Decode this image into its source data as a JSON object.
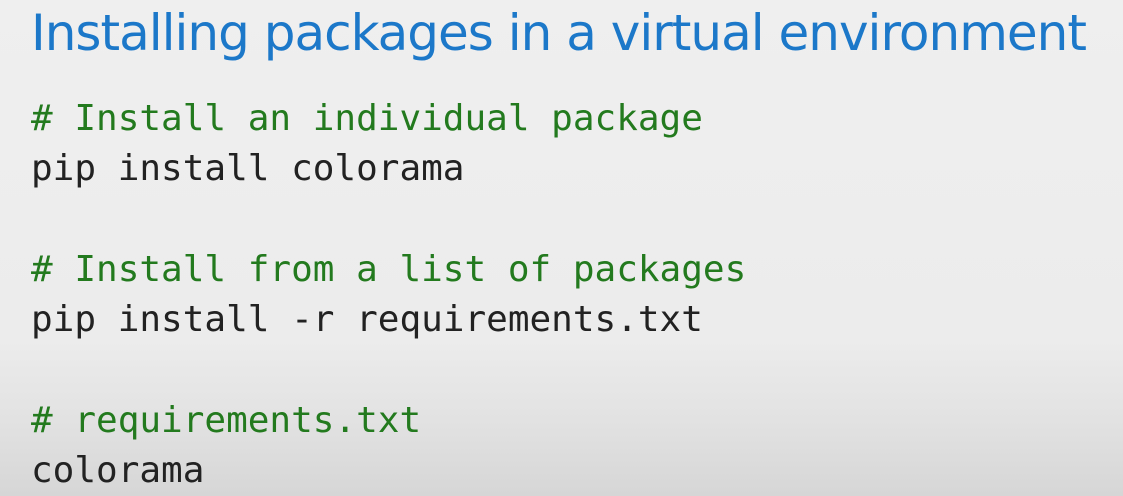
{
  "slide": {
    "title": "Installing packages in a virtual environment"
  },
  "code": {
    "lines": [
      {
        "kind": "comment",
        "text": "# Install an individual package"
      },
      {
        "kind": "command",
        "text": "pip install colorama"
      },
      {
        "kind": "comment",
        "text": "# Install from a list of packages"
      },
      {
        "kind": "command",
        "text": "pip install -r requirements.txt"
      },
      {
        "kind": "comment",
        "text": "# requirements.txt"
      },
      {
        "kind": "command",
        "text": "colorama"
      }
    ]
  },
  "colors": {
    "title": "#1c78c9",
    "comment": "#237a1e",
    "code": "#222222",
    "background": "#efefef"
  }
}
